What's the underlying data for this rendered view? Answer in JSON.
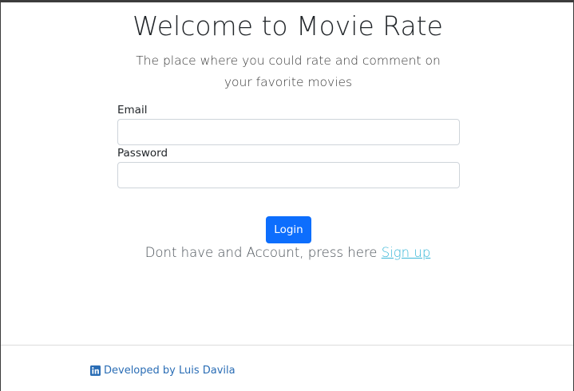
{
  "header": {
    "title": "Welcome to Movie Rate",
    "subtitle": "The place where you could rate and comment on your favorite movies"
  },
  "form": {
    "email_label": "Email",
    "email_value": "",
    "password_label": "Password",
    "password_value": "",
    "login_label": "Login"
  },
  "signup": {
    "prompt": "Dont have and Account, press here ",
    "link_label": "Sign up"
  },
  "footer": {
    "icon": "linkedin-icon",
    "credit": "Developed by Luis Davila"
  },
  "colors": {
    "primary_button": "#0d6efd",
    "signup_link": "#3bb8d8",
    "footer_link": "#2a6db5"
  }
}
